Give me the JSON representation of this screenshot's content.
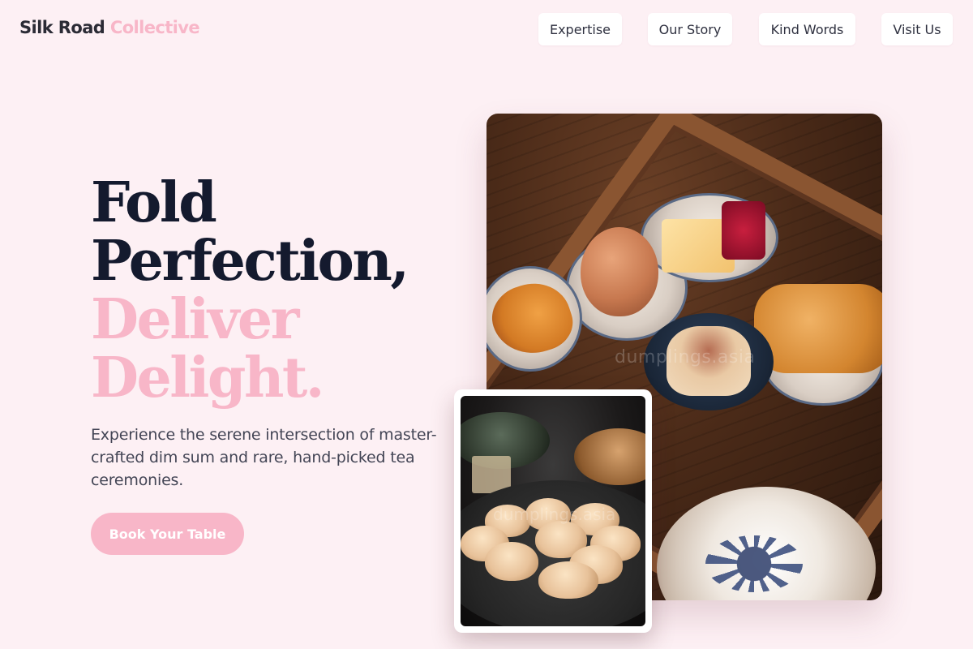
{
  "brand": {
    "name_primary": "Silk Road",
    "name_accent": "Collective"
  },
  "nav": {
    "items": [
      {
        "label": "Expertise"
      },
      {
        "label": "Our Story"
      },
      {
        "label": "Kind Words"
      },
      {
        "label": "Visit Us"
      }
    ]
  },
  "hero": {
    "headline_line1": "Fold",
    "headline_line2": "Perfection,",
    "headline_line3": "Deliver",
    "headline_line4": "Delight.",
    "description": "Experience the serene intersection of master-crafted dim sum and rare, hand-picked tea ceremonies.",
    "cta_label": "Book Your Table"
  },
  "images": {
    "main_watermark": "dumplings.asia",
    "inset_watermark": "dumplings.asia"
  },
  "colors": {
    "page_background": "#fdf0f4",
    "accent_pink": "#f8b6c8",
    "headline_dark": "#141a2e",
    "body_text": "#434555",
    "nav_button_bg": "#ffffff"
  }
}
